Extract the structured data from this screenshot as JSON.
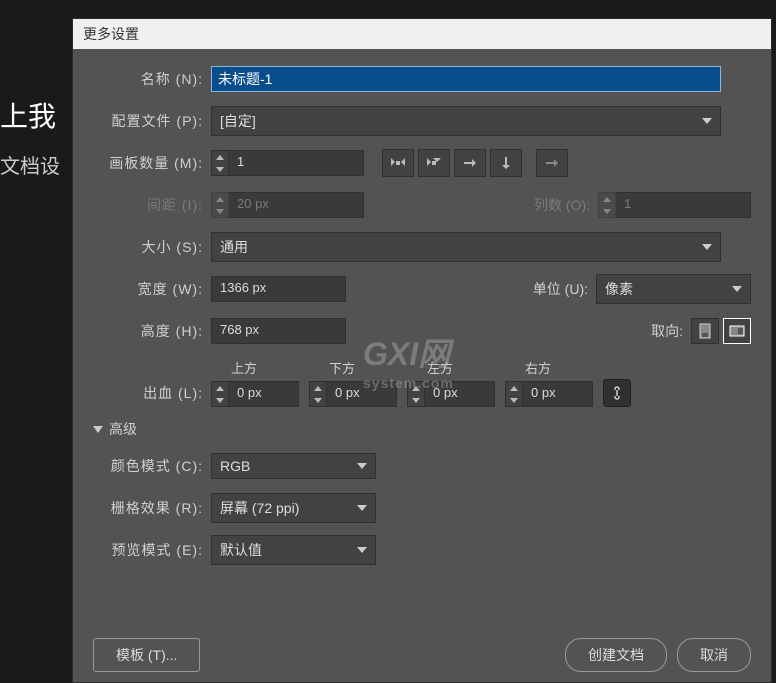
{
  "bg": {
    "line1": "上我",
    "line2": "文档设"
  },
  "dialog_title": "更多设置",
  "labels": {
    "name": "名称 (N):",
    "profile": "配置文件 (P):",
    "artboards": "画板数量 (M):",
    "spacing": "间距 (I):",
    "columns": "列数 (O):",
    "size": "大小 (S):",
    "width": "宽度 (W):",
    "height": "高度 (H):",
    "units": "单位 (U):",
    "orientation": "取向:",
    "bleed": "出血 (L):",
    "advanced": "高级",
    "colormode": "颜色模式 (C):",
    "raster": "栅格效果 (R):",
    "preview": "预览模式 (E):"
  },
  "values": {
    "name": "未标题-1",
    "profile": "[自定]",
    "artboards": "1",
    "spacing": "20 px",
    "columns": "1",
    "size": "通用",
    "width": "1366 px",
    "height": "768 px",
    "units": "像素",
    "colormode": "RGB",
    "raster": "屏幕 (72 ppi)",
    "preview": "默认值"
  },
  "bleed": {
    "top_label": "上方",
    "bottom_label": "下方",
    "left_label": "左方",
    "right_label": "右方",
    "top": "0 px",
    "bottom": "0 px",
    "left": "0 px",
    "right": "0 px"
  },
  "buttons": {
    "template": "模板 (T)...",
    "create": "创建文档",
    "cancel": "取消"
  },
  "watermark": {
    "main": "GXI网",
    "sub": "system.com"
  }
}
